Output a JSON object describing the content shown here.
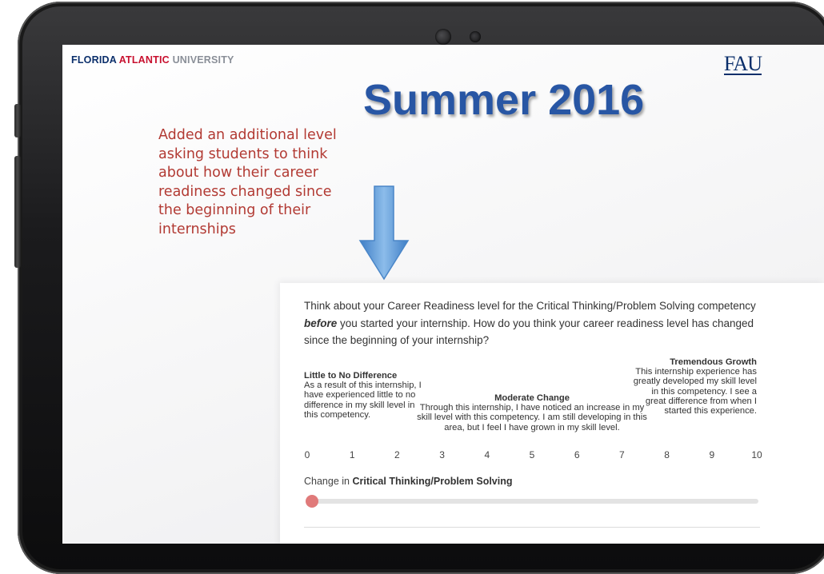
{
  "brand": {
    "part1": "FLORIDA",
    "part2": "ATLANTIC",
    "part3": "UNIVERSITY",
    "logo": "FAU"
  },
  "slide": {
    "title": "Summer 2016",
    "annotation": "Added an additional level asking students to think about how their career readiness changed since the beginning of their internships"
  },
  "survey": {
    "question_before": "Think about your Career Readiness level for the Critical Thinking/Problem Solving competency ",
    "question_emph": "before",
    "question_after": " you started your internship.  How do you think your career readiness level has changed since the beginning of your internship?",
    "low_label": "Little to No Difference",
    "low_desc": "As a result of this internship, I have experienced little to no difference in my skill level in this competency.",
    "mid_label": "Moderate Change",
    "mid_desc": "Through this internship, I have noticed an increase in my skill level with this competency. I am still developing in this area, but I feel I have grown in my skill level.",
    "high_label": "Tremendous Growth",
    "high_desc": "This internship experience has greatly developed my skill level in this competency.  I see a great difference from when I started this experience.",
    "scale_ticks": [
      "0",
      "1",
      "2",
      "3",
      "4",
      "5",
      "6",
      "7",
      "8",
      "9",
      "10"
    ],
    "slider_prefix": "Change in ",
    "slider_competency": "Critical Thinking/Problem Solving",
    "slider_value": 0,
    "slider_max": 10
  },
  "colors": {
    "title": "#2856a4",
    "annotation": "#b23a33",
    "brand_navy": "#0b2f6b",
    "brand_red": "#c8102e",
    "slider_thumb": "#e07a7a",
    "arrow": "#5b9bd5"
  }
}
